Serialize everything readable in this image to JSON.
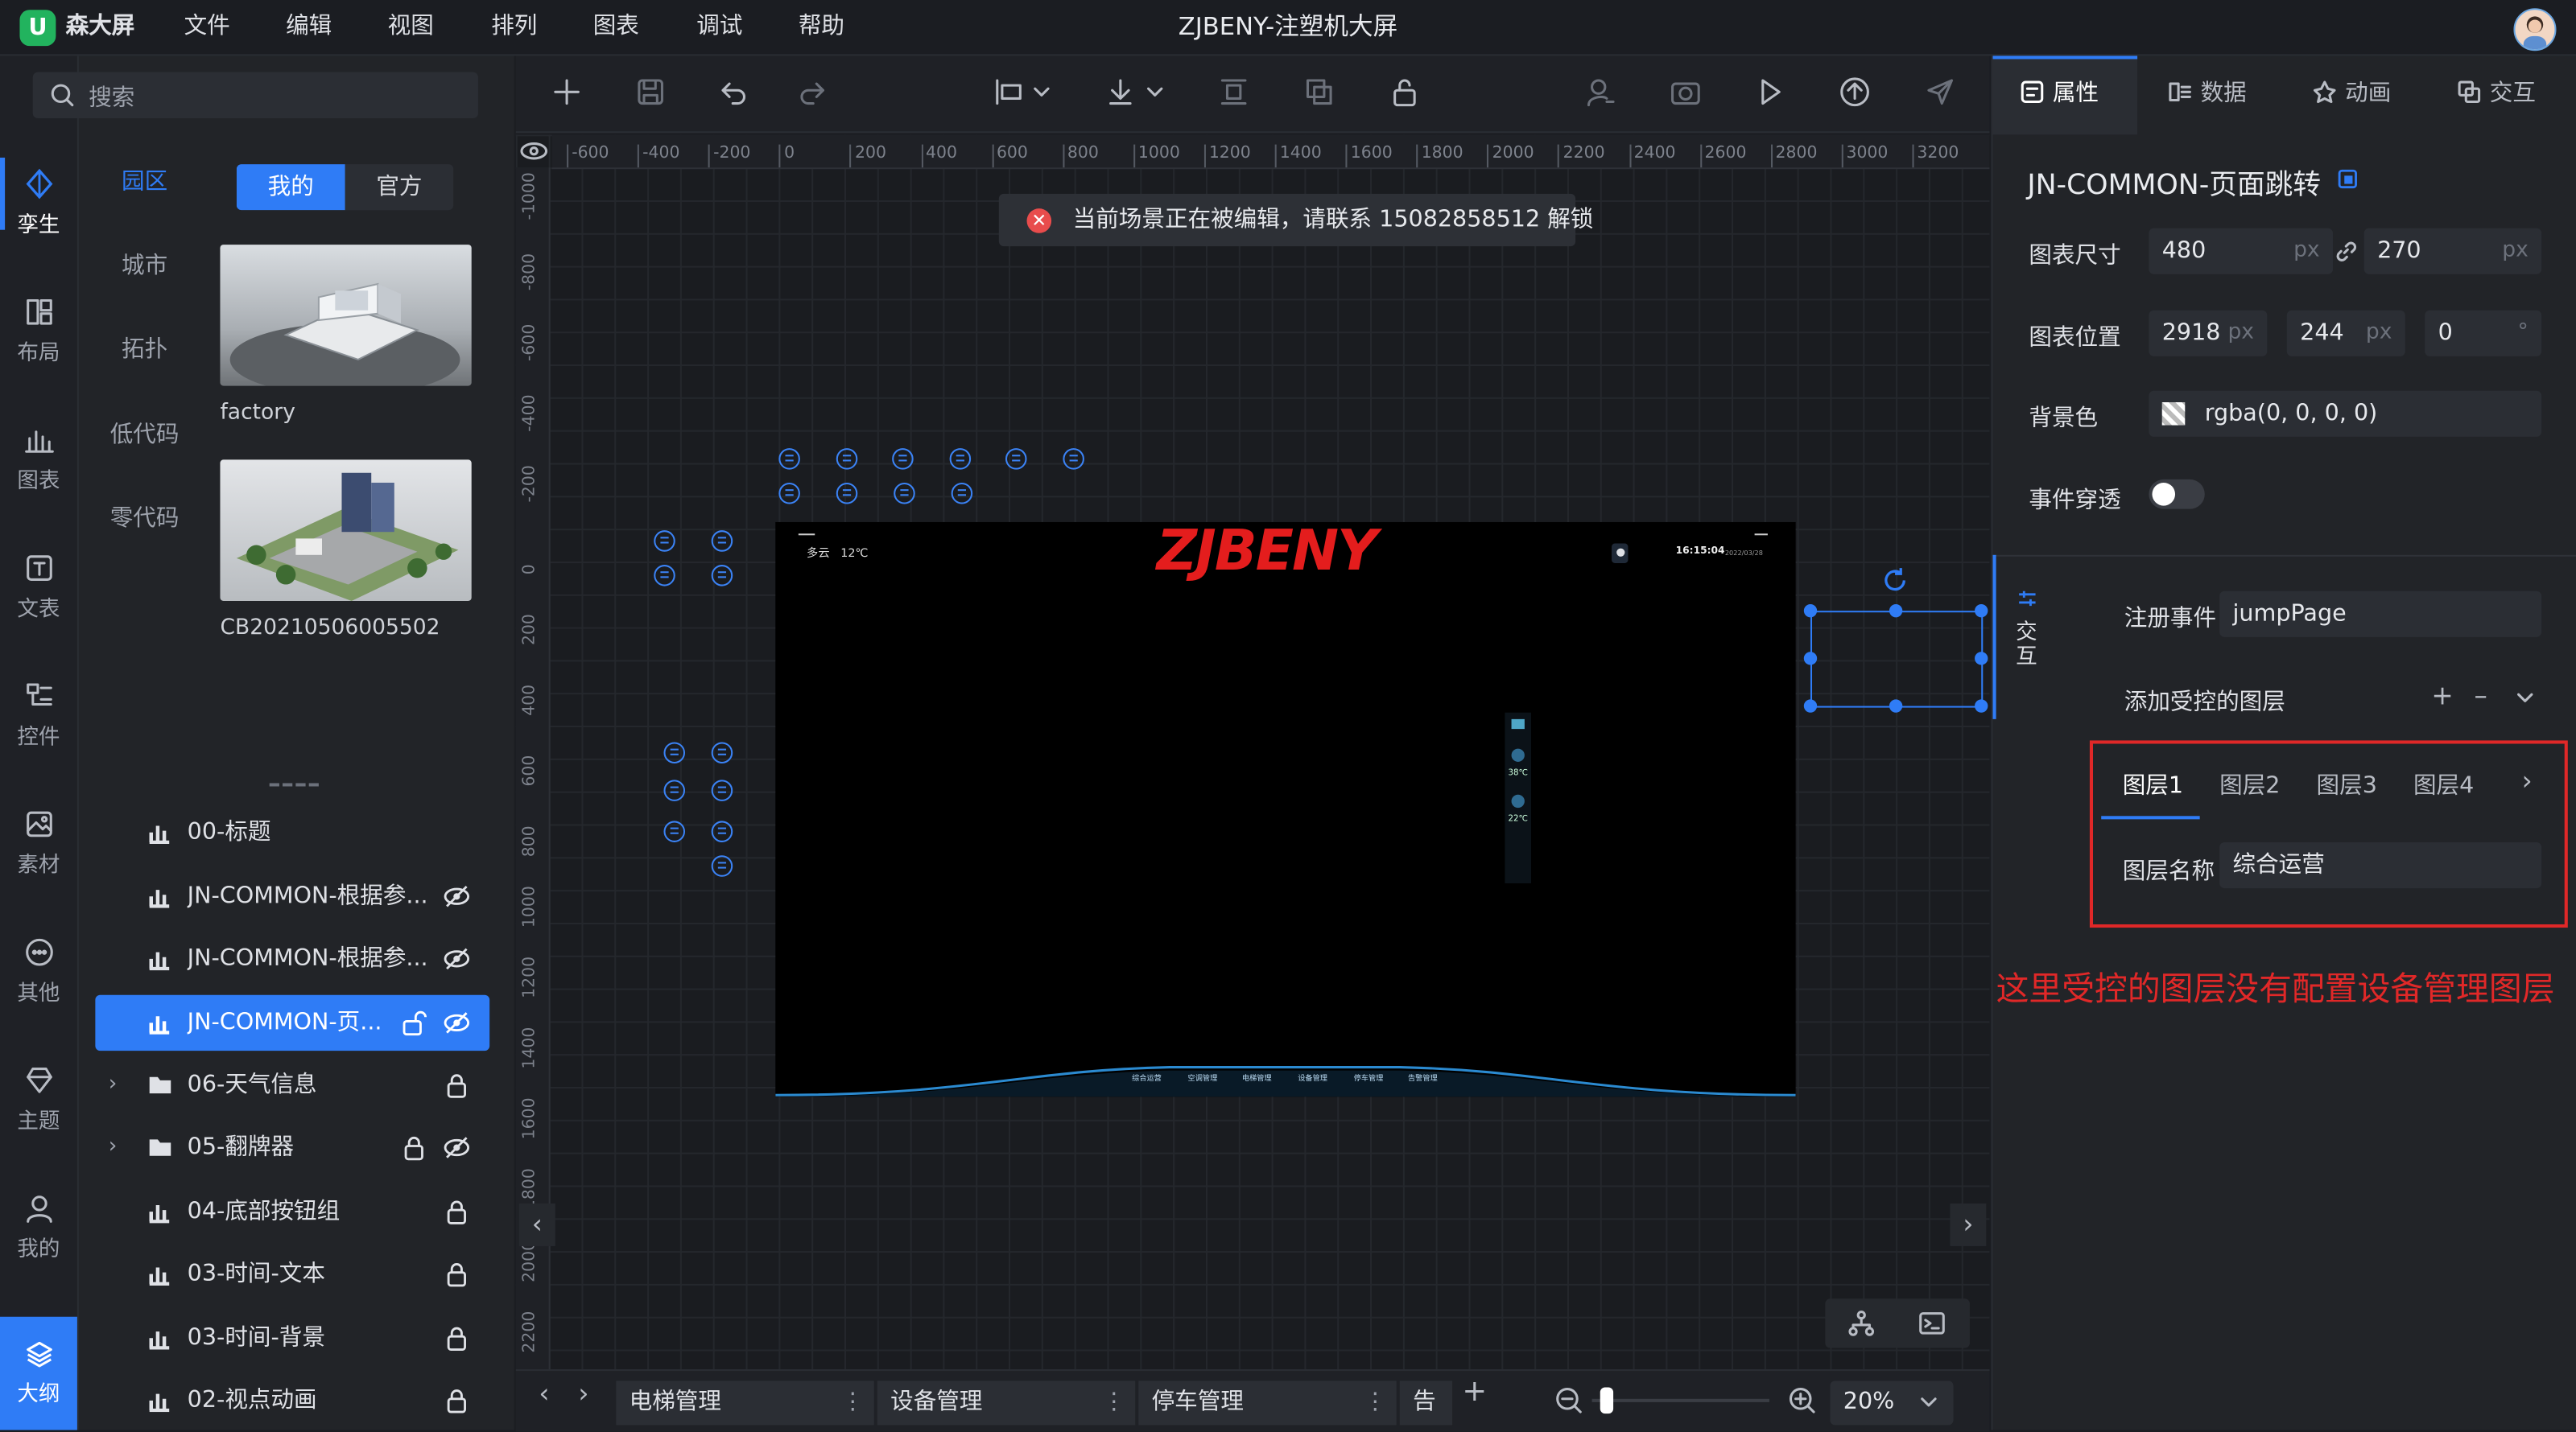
{
  "app": {
    "name": "森大屏",
    "title": "ZJBENY-注塑机大屏",
    "logo_letter": "U"
  },
  "menu": [
    "文件",
    "编辑",
    "视图",
    "排列",
    "图表",
    "调试",
    "帮助"
  ],
  "rail": {
    "items": [
      {
        "label": "孪生",
        "icon": "cube-icon",
        "active": true
      },
      {
        "label": "布局",
        "icon": "layout-icon"
      },
      {
        "label": "图表",
        "icon": "chart-icon"
      },
      {
        "label": "文表",
        "icon": "text-icon"
      },
      {
        "label": "控件",
        "icon": "widget-icon"
      },
      {
        "label": "素材",
        "icon": "image-icon"
      },
      {
        "label": "其他",
        "icon": "more-icon"
      },
      {
        "label": "主题",
        "icon": "diamond-icon"
      },
      {
        "label": "我的",
        "icon": "user-icon"
      }
    ],
    "bottom": {
      "label": "大纲",
      "icon": "layers-icon"
    }
  },
  "left_panel": {
    "search_placeholder": "搜索",
    "categories": [
      "园区",
      "城市",
      "拓扑",
      "低代码",
      "零代码"
    ],
    "segment": [
      "我的",
      "官方"
    ],
    "assets": [
      {
        "caption": "factory"
      },
      {
        "caption": "CB20210506005502"
      }
    ],
    "layers": [
      {
        "label": "00-标题",
        "type": "chart"
      },
      {
        "label": "JN-COMMON-根据参...",
        "type": "chart",
        "eye": true
      },
      {
        "label": "JN-COMMON-根据参...",
        "type": "chart",
        "eye": true
      },
      {
        "label": "JN-COMMON-页...",
        "type": "chart",
        "selected": true,
        "lock": true,
        "eye": true
      },
      {
        "label": "06-天气信息",
        "type": "folder",
        "lock": true
      },
      {
        "label": "05-翻牌器",
        "type": "folder",
        "lock": true,
        "eye": true
      },
      {
        "label": "04-底部按钮组",
        "type": "chart",
        "lock": true
      },
      {
        "label": "03-时间-文本",
        "type": "chart",
        "lock": true
      },
      {
        "label": "03-时间-背景",
        "type": "chart",
        "lock": true
      },
      {
        "label": "02-视点动画",
        "type": "chart",
        "lock": true
      }
    ]
  },
  "canvas": {
    "toast": "当前场景正在被编辑，请联系 15082858512 解锁",
    "ruler_h": [
      "-600",
      "-400",
      "-200",
      "0",
      "200",
      "400",
      "600",
      "800",
      "1000",
      "1200",
      "1400",
      "1600",
      "1800",
      "2000",
      "2200",
      "2400",
      "2600",
      "2800",
      "3000",
      "3200"
    ],
    "ruler_v": [
      "-1000",
      "-800",
      "-600",
      "-400",
      "-200",
      "0",
      "200",
      "400",
      "600",
      "800",
      "1000",
      "1200",
      "1400",
      "1600",
      "1800",
      "2000",
      "2200"
    ],
    "screen": {
      "brand": "ZJBENY",
      "weather": "多云   12℃",
      "time": "16:15:04",
      "date": "2022/03/28",
      "side_values": [
        "38℃",
        "22℃"
      ],
      "nav": [
        "综合运营",
        "空调管理",
        "电梯管理",
        "设备管理",
        "停车管理",
        "告警管理"
      ]
    }
  },
  "scene_tabs": [
    "电梯管理",
    "设备管理",
    "停车管理",
    "告警"
  ],
  "zoom": {
    "value": "20%",
    "level": 0.05
  },
  "right_panel": {
    "tabs": [
      "属性",
      "数据",
      "动画",
      "交互"
    ],
    "component_name": "JN-COMMON-页面跳转",
    "size_label": "图表尺寸",
    "width": "480",
    "height": "270",
    "unit": "px",
    "position_label": "图表位置",
    "pos_x": "2918",
    "pos_y": "244",
    "rotation": "0",
    "deg": "°",
    "bg_label": "背景色",
    "bg_value": "rgba(0, 0, 0, 0)",
    "passthrough_label": "事件穿透",
    "side_tab": "交互",
    "event_label": "注册事件",
    "event_value": "jumpPage",
    "controlled_label": "添加受控的图层",
    "layer_tabs": [
      "图层1",
      "图层2",
      "图层3",
      "图层4"
    ],
    "layer_name_label": "图层名称",
    "layer_name_value": "综合运营",
    "annotation": "这里受控的图层没有配置设备管理图层"
  },
  "colors": {
    "accent": "#2f7cf6",
    "brand_red": "#e02828",
    "annotation": "#e02828"
  }
}
